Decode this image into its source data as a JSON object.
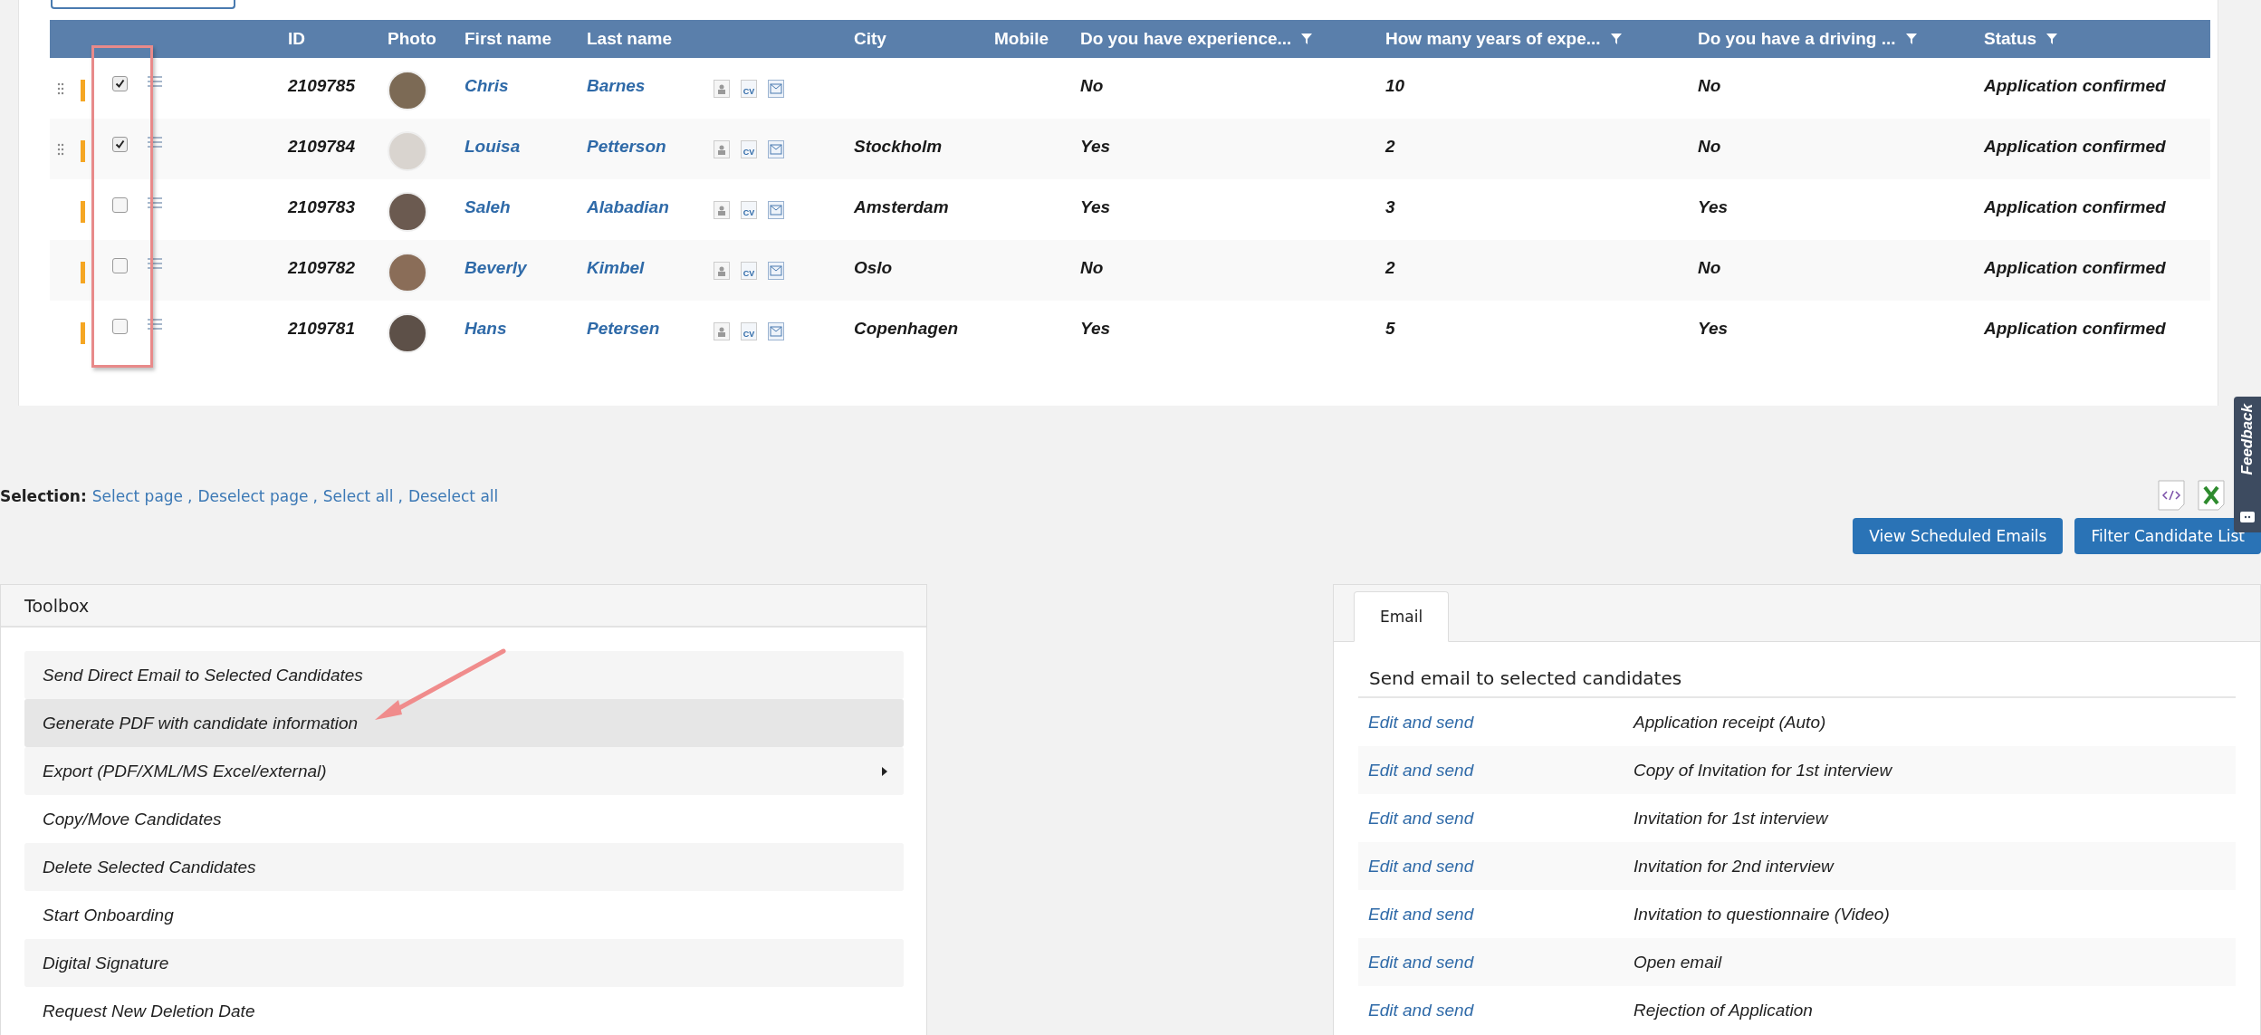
{
  "table": {
    "columns": [
      {
        "label": "ID",
        "filter": false
      },
      {
        "label": "Photo",
        "filter": false
      },
      {
        "label": "First name",
        "filter": false
      },
      {
        "label": "Last name",
        "filter": false
      },
      {
        "label": "City",
        "filter": false
      },
      {
        "label": "Mobile",
        "filter": false
      },
      {
        "label": "Do you have experience...",
        "filter": true
      },
      {
        "label": "How many years of expe...",
        "filter": true
      },
      {
        "label": "Do you have a driving ...",
        "filter": true
      },
      {
        "label": "Status",
        "filter": true
      }
    ],
    "rows": [
      {
        "checked": true,
        "id": "2109785",
        "first_name": "Chris",
        "last_name": "Barnes",
        "cv": "CV",
        "city": "",
        "experience": "No",
        "years": "10",
        "driving": "No",
        "status": "Application confirmed"
      },
      {
        "checked": true,
        "id": "2109784",
        "first_name": "Louisa",
        "last_name": "Petterson",
        "cv": "CV",
        "city": "Stockholm",
        "experience": "Yes",
        "years": "2",
        "driving": "No",
        "status": "Application confirmed"
      },
      {
        "checked": false,
        "id": "2109783",
        "first_name": "Saleh",
        "last_name": "Alabadian",
        "cv": "CV",
        "city": "Amsterdam",
        "experience": "Yes",
        "years": "3",
        "driving": "Yes",
        "status": "Application confirmed"
      },
      {
        "checked": false,
        "id": "2109782",
        "first_name": "Beverly",
        "last_name": "Kimbel",
        "cv": "CV",
        "city": "Oslo",
        "experience": "No",
        "years": "2",
        "driving": "No",
        "status": "Application confirmed"
      },
      {
        "checked": false,
        "id": "2109781",
        "first_name": "Hans",
        "last_name": "Petersen",
        "cv": "CV",
        "city": "Copenhagen",
        "experience": "Yes",
        "years": "5",
        "driving": "Yes",
        "status": "Application confirmed"
      }
    ]
  },
  "selection": {
    "label": "Selection:",
    "links": [
      {
        "label": "Select page",
        "separator": ","
      },
      {
        "label": "Deselect page",
        "separator": ","
      },
      {
        "label": "Select all",
        "separator": ","
      },
      {
        "label": "Deselect all"
      }
    ]
  },
  "buttons": [
    "View Scheduled Emails",
    "Filter Candidate List"
  ],
  "feedback": "Feedback",
  "toolbox": {
    "title": "Toolbox",
    "items": [
      {
        "label": "Send Direct Email to Selected Candidates",
        "hovered": false,
        "submenu": false
      },
      {
        "label": "Generate PDF with candidate information",
        "hovered": true,
        "submenu": false
      },
      {
        "label": "Export (PDF/XML/MS Excel/external)",
        "hovered": false,
        "submenu": true
      },
      {
        "label": "Copy/Move Candidates",
        "hovered": false,
        "submenu": false
      },
      {
        "label": "Delete Selected Candidates",
        "hovered": false,
        "submenu": false
      },
      {
        "label": "Start Onboarding",
        "hovered": false,
        "submenu": false
      },
      {
        "label": "Digital Signature",
        "hovered": false,
        "submenu": false
      },
      {
        "label": "Request New Deletion Date",
        "hovered": false,
        "submenu": false
      }
    ]
  },
  "email": {
    "tabs": [
      {
        "label": "Email",
        "selected": true
      }
    ],
    "heading": "Send email to selected candidates",
    "rows": [
      {
        "action": "Edit and send",
        "template": "Application receipt (Auto)"
      },
      {
        "action": "Edit and send",
        "template": "Copy of Invitation for 1st interview"
      },
      {
        "action": "Edit and send",
        "template": "Invitation for 1st interview"
      },
      {
        "action": "Edit and send",
        "template": "Invitation for 2nd interview"
      },
      {
        "action": "Edit and send",
        "template": "Invitation to questionnaire (Video)"
      },
      {
        "action": "Edit and send",
        "template": "Open email"
      },
      {
        "action": "Edit and send",
        "template": "Rejection of Application"
      }
    ]
  }
}
